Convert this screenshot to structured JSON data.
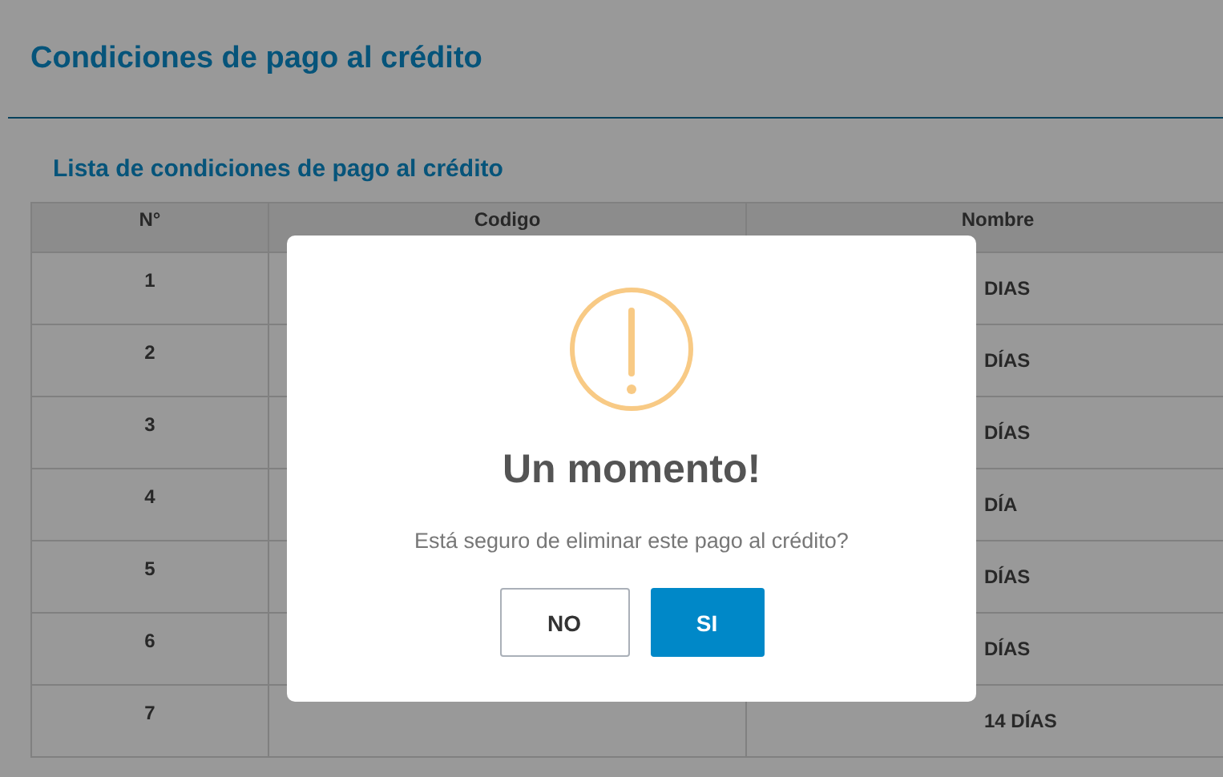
{
  "page": {
    "title": "Condiciones de pago al crédito"
  },
  "list": {
    "title": "Lista de condiciones de pago al crédito",
    "columns": [
      "N°",
      "Codigo",
      "Nombre"
    ],
    "rows": [
      {
        "number": "1",
        "name": "DIAS"
      },
      {
        "number": "2",
        "name": "DÍAS"
      },
      {
        "number": "3",
        "name": "DÍAS"
      },
      {
        "number": "4",
        "name": "DÍA"
      },
      {
        "number": "5",
        "name": "DÍAS"
      },
      {
        "number": "6",
        "name": "DÍAS"
      },
      {
        "number": "7",
        "name": "14 DÍAS"
      }
    ]
  },
  "dialog": {
    "kind": "warning",
    "title": "Un momento!",
    "message": "Está seguro de eliminar este pago al crédito?",
    "buttons": [
      {
        "label": "NO",
        "kind": "cancel"
      },
      {
        "label": "SI",
        "kind": "confirm"
      }
    ]
  }
}
